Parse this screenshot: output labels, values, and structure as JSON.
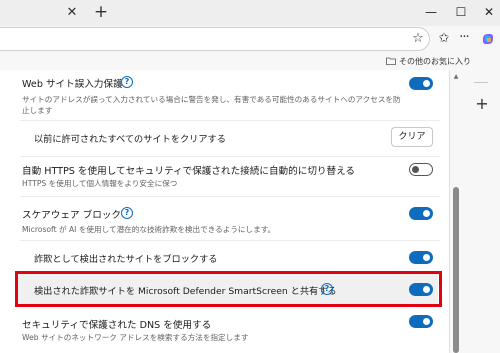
{
  "titlebar": {
    "tab_close_glyph": "✕",
    "new_tab_glyph": "+",
    "minimize_glyph": "—",
    "maximize_glyph": "☐",
    "close_glyph": "✕"
  },
  "toolbar": {
    "star_glyph": "☆",
    "favorites_glyph": "✩",
    "more_glyph": "···",
    "copilot_icon": "copilot-icon"
  },
  "favorites_bar": {
    "other_favorites_label": "その他のお気に入り"
  },
  "settings": {
    "typosquatting": {
      "title": "Web サイト誤入力保護",
      "description": "サイトのアドレスが誤って入力されている場合に警告を発し、有害である可能性のあるサイトへのアクセスを防止します",
      "enabled": true
    },
    "clear_allowed": {
      "title": "以前に許可されたすべてのサイトをクリアする",
      "button_label": "クリア"
    },
    "https_upgrade": {
      "title": "自動 HTTPS を使用してセキュリティで保護された接続に自動的に切り替える",
      "description": "HTTPS を使用して個人情報をより安全に保つ",
      "enabled": false
    },
    "scareware_block": {
      "title": "スケアウェア ブロック",
      "description": "Microsoft が AI を使用して潜在的な技術詐欺を検出できるようにします。",
      "enabled": true
    },
    "block_detected": {
      "title": "詐欺として検出されたサイトをブロックする",
      "enabled": true
    },
    "share_smartscreen": {
      "title": "検出された詐欺サイトを Microsoft Defender SmartScreen と共有する",
      "enabled": true
    },
    "secure_dns": {
      "title": "セキュリティで保護された DNS を使用する",
      "description": "Web サイトのネットワーク アドレスを検索する方法を指定します",
      "enabled": true
    },
    "help_glyph": "?"
  },
  "sidebar": {
    "add_glyph": "+"
  },
  "colors": {
    "accent": "#0f6cbd",
    "highlight_border": "#e3000f"
  }
}
